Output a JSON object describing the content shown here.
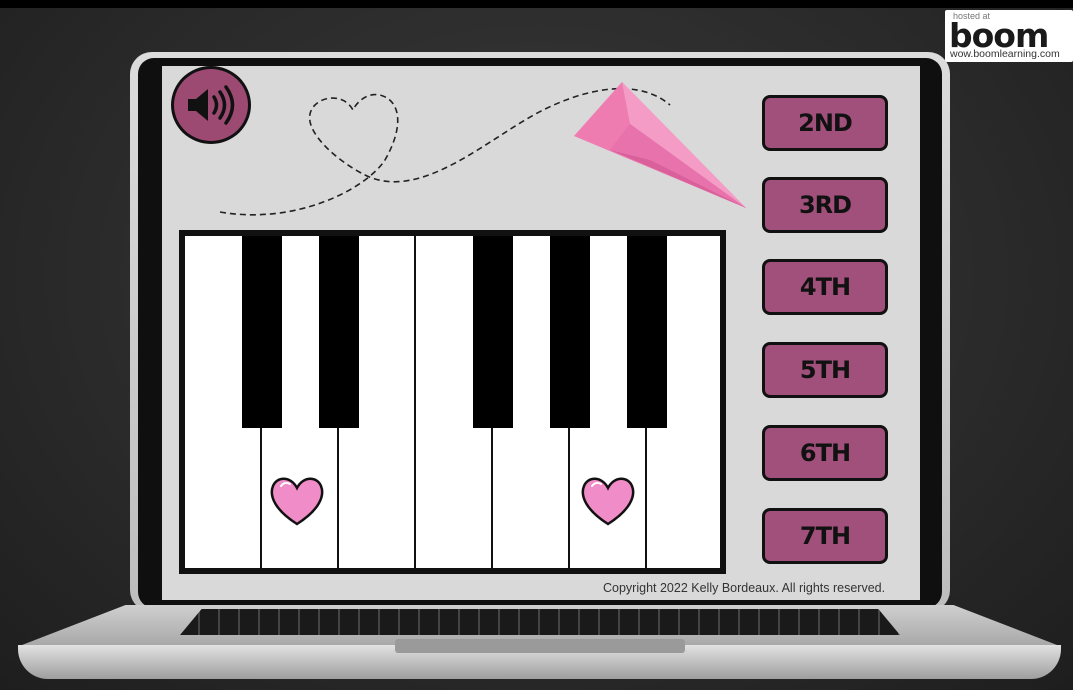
{
  "branding": {
    "hosted_label": "hosted at",
    "logo_text": "boom",
    "url": "wow.boomlearning.com"
  },
  "toolbar": {
    "audio_icon": "speaker-icon"
  },
  "answers": [
    {
      "label": "2ND"
    },
    {
      "label": "3RD"
    },
    {
      "label": "4TH"
    },
    {
      "label": "5TH"
    },
    {
      "label": "6TH"
    },
    {
      "label": "7TH"
    }
  ],
  "piano": {
    "white_key_count": 7,
    "black_key_count": 5,
    "marked_keys": [
      2,
      6
    ],
    "marker_icon": "heart-icon"
  },
  "decor": {
    "plane_icon": "paper-airplane-icon"
  },
  "footer": {
    "copyright": "Copyright 2022 Kelly Bordeaux. All rights reserved."
  },
  "colors": {
    "button_fill": "#a0507a",
    "speaker_fill": "#9c4a72",
    "heart_fill": "#f08cc8",
    "plane_fill": "#ef7cb0",
    "screen_bg": "#d9d9d9"
  }
}
